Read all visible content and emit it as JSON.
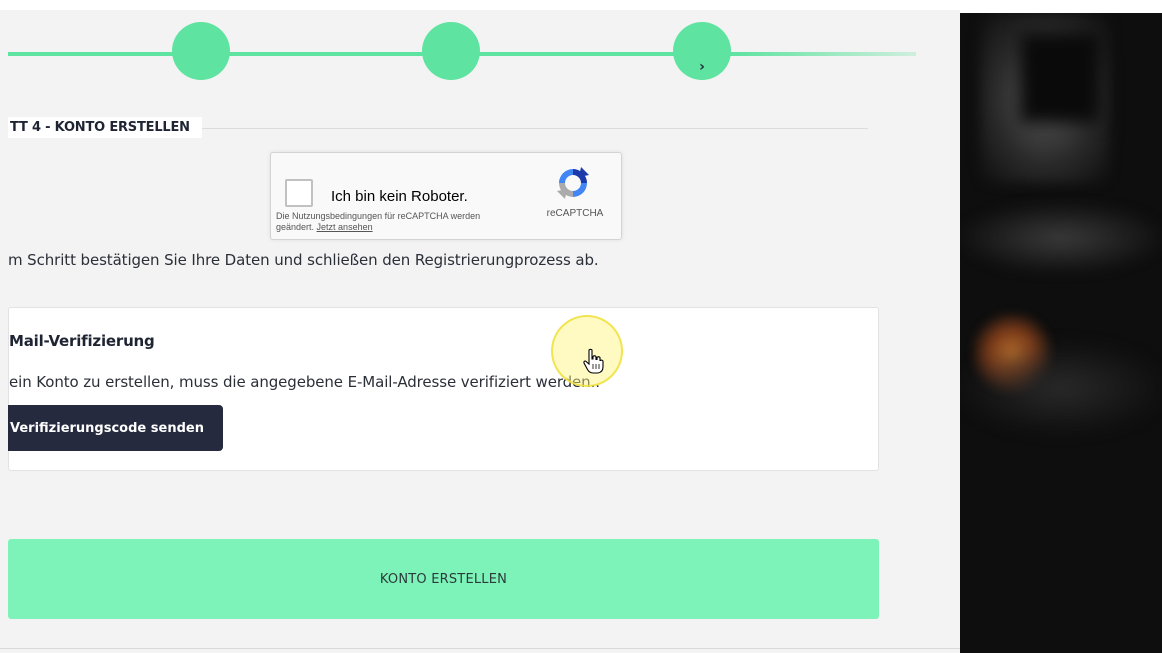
{
  "section": {
    "title": "TT 4 - KONTO ERSTELLEN"
  },
  "recaptcha": {
    "label": "Ich bin kein Roboter.",
    "terms_text": "Die Nutzungsbedingungen für reCAPTCHA werden geändert.",
    "terms_link": "Jetzt ansehen",
    "brand": "reCAPTCHA"
  },
  "confirm_text": "m Schritt bestätigen Sie Ihre Daten und schließen den Registrierungprozess ab.",
  "verification": {
    "title": "Mail-Verifizierung",
    "text": "ein Konto zu erstellen, muss die angegebene E-Mail-Adresse verifiziert werden..",
    "button_label": "Verifizierungscode senden"
  },
  "create_button_label": "KONTO ERSTELLEN",
  "colors": {
    "accent_green": "#5fe3a1",
    "button_green": "#7df3b9",
    "dark_button": "#252a3e",
    "cursor_highlight": "#fff478"
  }
}
